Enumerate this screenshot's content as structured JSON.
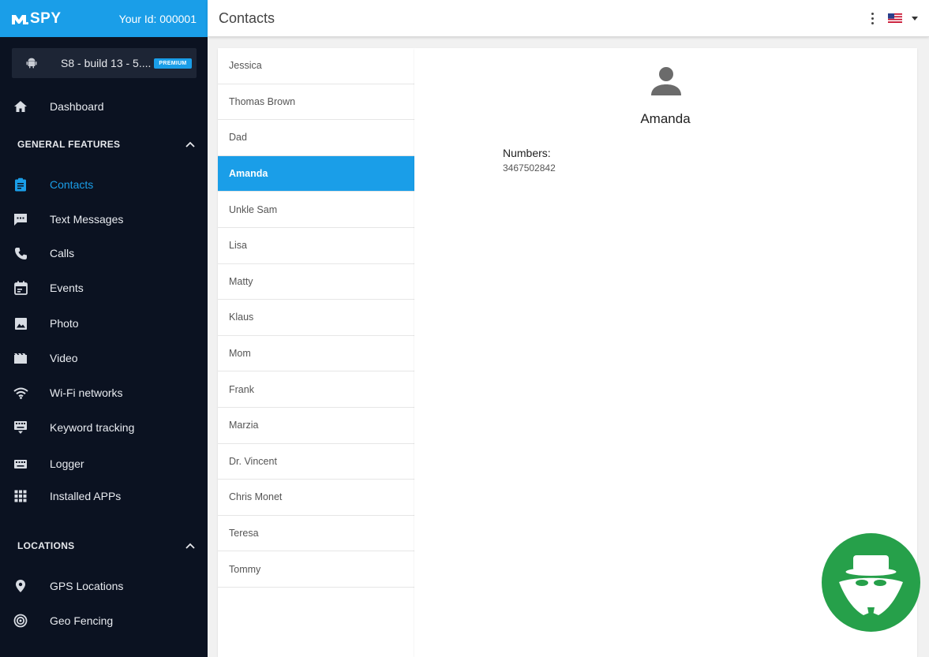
{
  "brand": {
    "logo_text": "SPY",
    "user_id": "Your Id: 000001"
  },
  "device": {
    "name": "S8 - build 13 - 5....",
    "badge": "PREMIUM"
  },
  "nav": {
    "dashboard": "Dashboard",
    "general_features": "GENERAL FEATURES",
    "contacts": "Contacts",
    "text_messages": "Text Messages",
    "calls": "Calls",
    "events": "Events",
    "photo": "Photo",
    "video": "Video",
    "wifi": "Wi-Fi networks",
    "keyword_tracking": "Keyword tracking",
    "logger": "Logger",
    "installed_apps": "Installed APPs",
    "locations": "LOCATIONS",
    "gps_locations": "GPS Locations",
    "geo_fencing": "Geo Fencing"
  },
  "header": {
    "title": "Contacts"
  },
  "contacts": [
    "Jessica",
    "Thomas Brown",
    "Dad",
    "Amanda",
    "Unkle Sam",
    "Lisa",
    "Matty",
    "Klaus",
    "Mom",
    "Frank",
    "Marzia",
    "Dr. Vincent",
    "Chris Monet",
    "Teresa",
    "Tommy"
  ],
  "selected_contact": {
    "name": "Amanda",
    "numbers_label": "Numbers:",
    "number": "3467502842"
  },
  "colors": {
    "accent": "#1a9ee8",
    "sidebar": "#0b1221",
    "badge_green": "#26a04a"
  },
  "icons": [
    "android-icon",
    "home-icon",
    "clipboard-icon",
    "chat-icon",
    "phone-icon",
    "calendar-icon",
    "image-icon",
    "film-icon",
    "wifi-icon",
    "keyboard-icon",
    "grid-icon",
    "location-pin-icon",
    "target-icon",
    "user-icon",
    "spy-icon",
    "us-flag-icon"
  ]
}
